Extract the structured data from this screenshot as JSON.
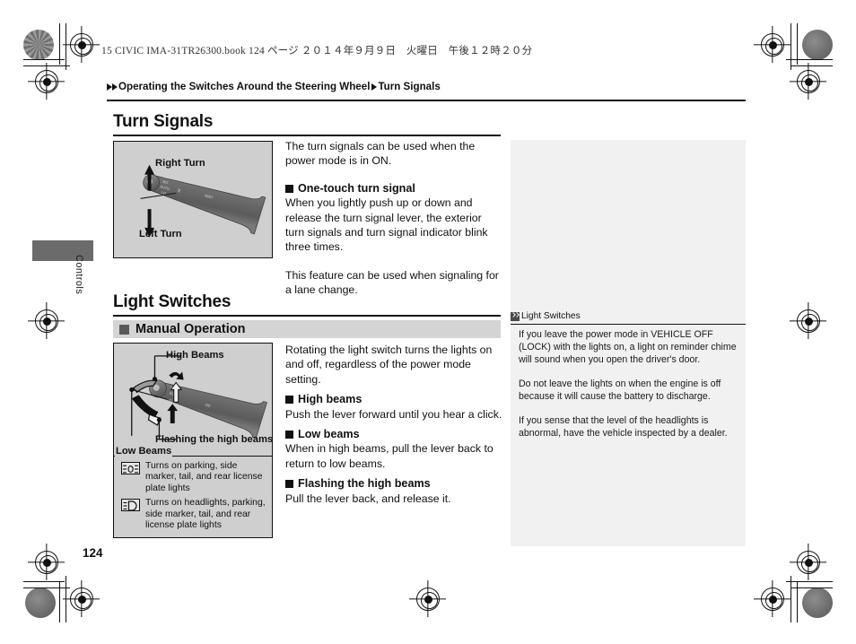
{
  "print_header": "15 CIVIC IMA-31TR26300.book   124 ページ   ２０１４年９月９日　火曜日　午後１２時２０分",
  "breadcrumb": {
    "part1": "Operating the Switches Around the Steering Wheel",
    "part2": "Turn Signals"
  },
  "thumb_tab": {
    "label": "Controls"
  },
  "page_number": "124",
  "sections": {
    "turn_signals": {
      "title": "Turn Signals",
      "figure": {
        "label_top": "Right Turn",
        "label_bottom": "Left Turn"
      },
      "intro": "The turn signals can be used when the power mode is in ON.",
      "sub1_title": "One-touch turn signal",
      "sub1_body": "When you lightly push up or down and release the turn signal lever, the exterior turn signals and turn signal indicator blink three times.",
      "closing": "This feature can be used when signaling for a lane change."
    },
    "light_switches": {
      "title": "Light Switches",
      "subsection": "Manual Operation",
      "figure": {
        "label_high": "High Beams",
        "label_flash": "Flashing the high beams",
        "label_low": "Low Beams"
      },
      "legend": [
        {
          "icon": "parking-lights-icon",
          "text": "Turns on parking, side marker, tail, and rear license plate lights"
        },
        {
          "icon": "headlights-icon",
          "text": "Turns on headlights, parking, side marker, tail, and rear license plate lights"
        }
      ],
      "intro": "Rotating the light switch turns the lights on and off, regardless of the power mode setting.",
      "sub1_title": "High beams",
      "sub1_body": "Push the lever forward until you hear a click.",
      "sub2_title": "Low beams",
      "sub2_body": "When in high beams, pull the lever back to return to low beams.",
      "sub3_title": "Flashing the high beams",
      "sub3_body": "Pull the lever back, and release it."
    }
  },
  "info_panel": {
    "icon": "double-chevron-icon",
    "title": "Light Switches",
    "paragraphs": [
      "If you leave the power mode in VEHICLE OFF (LOCK) with the lights on, a light on reminder chime will sound when you open the driver's door.",
      "Do not leave the lights on when the engine is off because it will cause the battery to discharge.",
      "If you sense that the level of the headlights is abnormal, have the vehicle inspected by a dealer."
    ]
  },
  "colors": {
    "figure_bg": "#cfcfcf",
    "subband_bg": "#d4d4d4",
    "info_panel_bg": "#f1f1f1",
    "thumb_tab": "#6b6b6b",
    "text": "#111111"
  }
}
